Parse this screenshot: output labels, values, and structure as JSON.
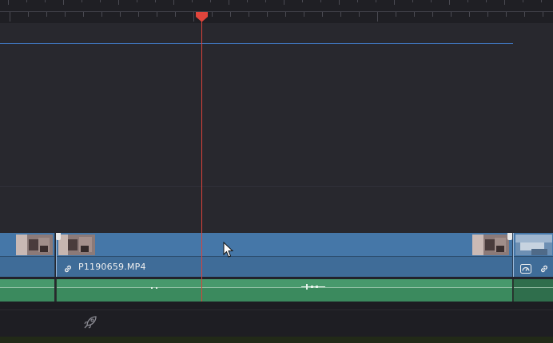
{
  "timeline": {
    "clips": {
      "video_main_name": "P1190659.MP4"
    },
    "icons": {
      "link": "link-icon",
      "speed": "speedometer-icon",
      "render_cache": "rocket-icon"
    },
    "colors": {
      "playhead": "#d9423a",
      "video_clip": "#4577a8",
      "audio_clip": "#3b8a5e",
      "track_guide": "#3f72b8",
      "background": "#28282e"
    }
  }
}
